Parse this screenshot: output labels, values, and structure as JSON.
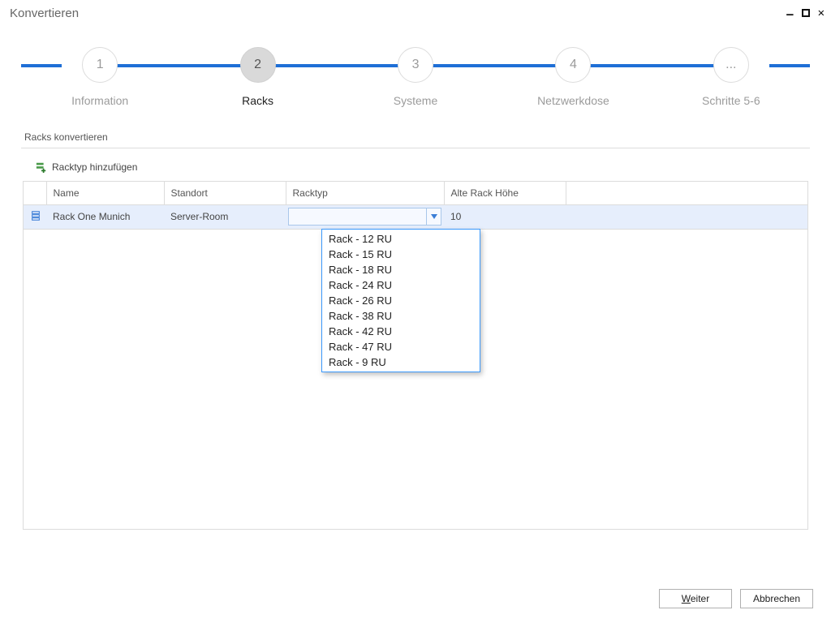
{
  "window_title": "Konvertieren",
  "steps": [
    {
      "num": "1",
      "label": "Information",
      "active": false
    },
    {
      "num": "2",
      "label": "Racks",
      "active": true
    },
    {
      "num": "3",
      "label": "Systeme",
      "active": false
    },
    {
      "num": "4",
      "label": "Netzwerkdose",
      "active": false
    },
    {
      "num": "...",
      "label": "Schritte 5-6",
      "active": false
    }
  ],
  "section_title": "Racks konvertieren",
  "add_rack_label": "Racktyp hinzufügen",
  "table": {
    "headers": {
      "name": "Name",
      "standort": "Standort",
      "racktyp": "Racktyp",
      "alte_hoehe": "Alte Rack Höhe"
    },
    "rows": [
      {
        "name": "Rack One Munich",
        "standort": "Server-Room",
        "racktyp": "",
        "alte_hoehe": "10"
      }
    ]
  },
  "dropdown_options": [
    "Rack - 12 RU",
    "Rack - 15 RU",
    "Rack - 18 RU",
    "Rack - 24 RU",
    "Rack - 26 RU",
    "Rack - 38 RU",
    "Rack - 42 RU",
    "Rack - 47 RU",
    "Rack - 9 RU"
  ],
  "buttons": {
    "next_prefix": "W",
    "next_rest": "eiter",
    "cancel": "Abbrechen"
  }
}
